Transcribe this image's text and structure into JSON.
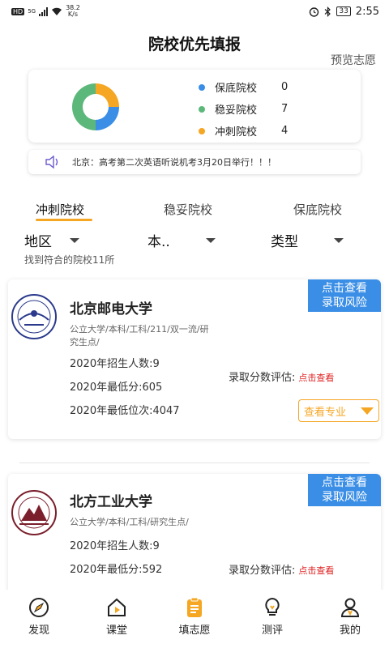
{
  "status_bar": {
    "left_badge": "HD",
    "network": "5G",
    "speed_value": "38.2",
    "speed_unit": "K/s",
    "battery": "33",
    "time": "2:55"
  },
  "header": {
    "title": "院校优先填报",
    "preview_link": "预览志愿"
  },
  "summary": {
    "items": [
      {
        "label": "保底院校",
        "count": "0",
        "color": "#3a8ee6"
      },
      {
        "label": "稳妥院校",
        "count": "7",
        "color": "#5cb87a"
      },
      {
        "label": "冲刺院校",
        "count": "4",
        "color": "#f5a623"
      }
    ]
  },
  "notice": {
    "text": "北京：高考第二次英语听说机考3月20日举行！！！"
  },
  "tabs": [
    {
      "label": "冲刺院校",
      "active": true
    },
    {
      "label": "稳妥院校",
      "active": false
    },
    {
      "label": "保底院校",
      "active": false
    }
  ],
  "filters": {
    "region": "地区",
    "level": "本..",
    "type": "类型",
    "result_count": "找到符合的院校11所"
  },
  "schools": [
    {
      "name": "北京邮电大学",
      "tags": "公立大学/本科/工科/211/双一流/研究生点/",
      "enroll": "2020年招生人数:9",
      "min_score": "2020年最低分:605",
      "min_rank": "2020年最低位次:4047",
      "eval_label": "录取分数评估:",
      "eval_link": "点击查看",
      "risk_line1": "点击查看",
      "risk_line2": "录取风险",
      "major_btn": "查看专业"
    },
    {
      "name": "北方工业大学",
      "tags": "公立大学/本科/工科/研究生点/",
      "enroll": "2020年招生人数:9",
      "min_score": "2020年最低分:592",
      "eval_label": "录取分数评估:",
      "eval_link": "点击查看",
      "risk_line1": "点击查看",
      "risk_line2": "录取风险"
    }
  ],
  "bottom_nav": [
    {
      "label": "发现",
      "icon": "compass-icon"
    },
    {
      "label": "课堂",
      "icon": "play-house-icon"
    },
    {
      "label": "填志愿",
      "icon": "clipboard-icon",
      "active": true
    },
    {
      "label": "测评",
      "icon": "lightbulb-icon"
    },
    {
      "label": "我的",
      "icon": "user-icon"
    }
  ],
  "colors": {
    "accent": "#f5a623",
    "blue": "#3a8ee6",
    "green": "#5cb87a",
    "red": "#e02020"
  }
}
